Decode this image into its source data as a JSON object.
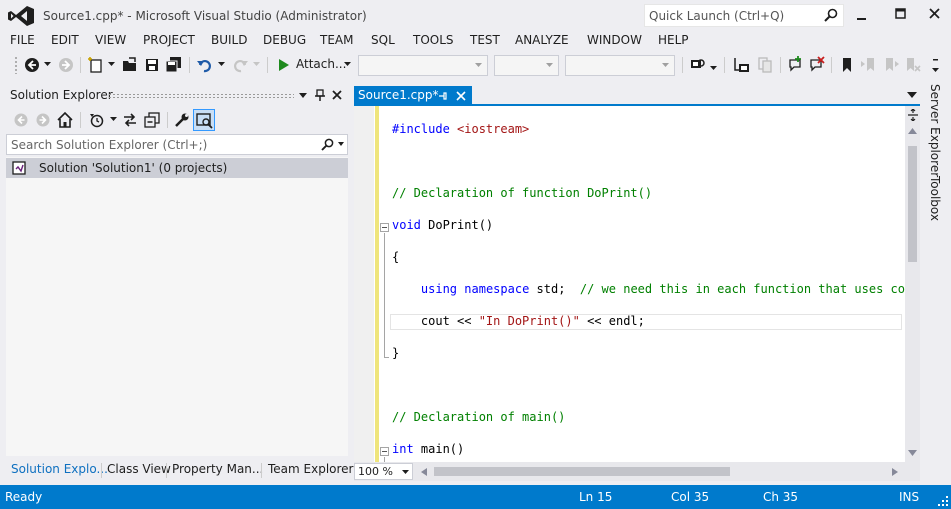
{
  "window": {
    "title": "Source1.cpp* - Microsoft Visual Studio (Administrator)",
    "quick_launch_placeholder": "Quick Launch (Ctrl+Q)"
  },
  "menu": [
    "FILE",
    "EDIT",
    "VIEW",
    "PROJECT",
    "BUILD",
    "DEBUG",
    "TEAM",
    "SQL",
    "TOOLS",
    "TEST",
    "ANALYZE",
    "WINDOW",
    "HELP"
  ],
  "toolbar": {
    "attach_label": "Attach..."
  },
  "solution_explorer": {
    "title": "Solution Explorer",
    "search_placeholder": "Search Solution Explorer (Ctrl+;)",
    "root_node": "Solution 'Solution1' (0 projects)"
  },
  "bottom_tabs": [
    "Solution Explo...",
    "Class View",
    "Property Man...",
    "Team Explorer"
  ],
  "editor": {
    "tab_label": "Source1.cpp*",
    "zoom": "100 %"
  },
  "side_tabs": [
    "Server Explorer",
    "Toolbox"
  ],
  "code": [
    {
      "text": "#include <iostream>"
    },
    {
      "text": ""
    },
    {
      "text": "// Declaration of function DoPrint()"
    },
    {
      "text": "void DoPrint()"
    },
    {
      "text": "{"
    },
    {
      "text": "    using namespace std;  // we need this in each function that uses cout"
    },
    {
      "text": "    cout << \"In DoPrint()\" << endl;"
    },
    {
      "text": "}"
    },
    {
      "text": ""
    },
    {
      "text": "// Declaration of main()"
    },
    {
      "text": "int main()"
    }
  ],
  "status": {
    "ready": "Ready",
    "line": "Ln 15",
    "col": "Col 35",
    "ch": "Ch 35",
    "mode": "INS"
  },
  "colors": {
    "accent": "#007acc",
    "keyword": "#0000ff",
    "comment": "#008000",
    "string": "#a31515",
    "vs_logo": "#68217a"
  }
}
